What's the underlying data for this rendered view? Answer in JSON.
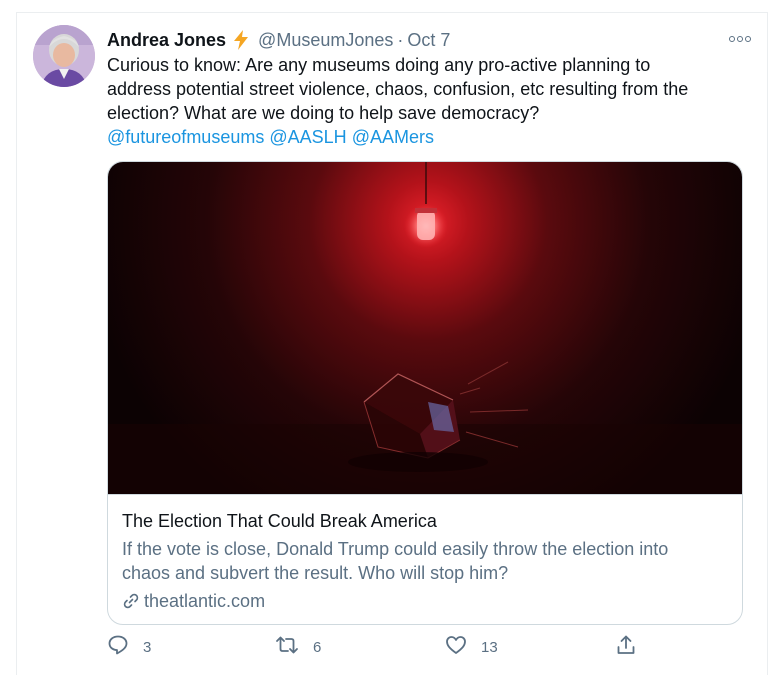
{
  "tweet": {
    "author": {
      "display_name": "Andrea Jones",
      "badge_icon": "lightning-bolt-icon",
      "handle": "@MuseumJones",
      "separator": "·",
      "date": "Oct 7"
    },
    "text_lines": [
      "Curious to know: Are any museums doing any pro-active planning to",
      "address potential street violence, chaos, confusion, etc resulting from the",
      "election? What are we doing to help save democracy?"
    ],
    "mentions": [
      "@futureofmuseums",
      "@AASLH",
      "@AAMers"
    ],
    "card": {
      "title": "The Election That Could Break America",
      "description_lines": [
        "If the vote is close, Donald Trump could easily throw the election into",
        "chaos and subvert the result. Who will stop him?"
      ],
      "domain": "theatlantic.com"
    },
    "actions": {
      "reply_count": "3",
      "retweet_count": "6",
      "like_count": "13"
    },
    "colors": {
      "accent": "#1b95e0",
      "muted": "#5b7083",
      "bolt": "#f5a623"
    }
  }
}
